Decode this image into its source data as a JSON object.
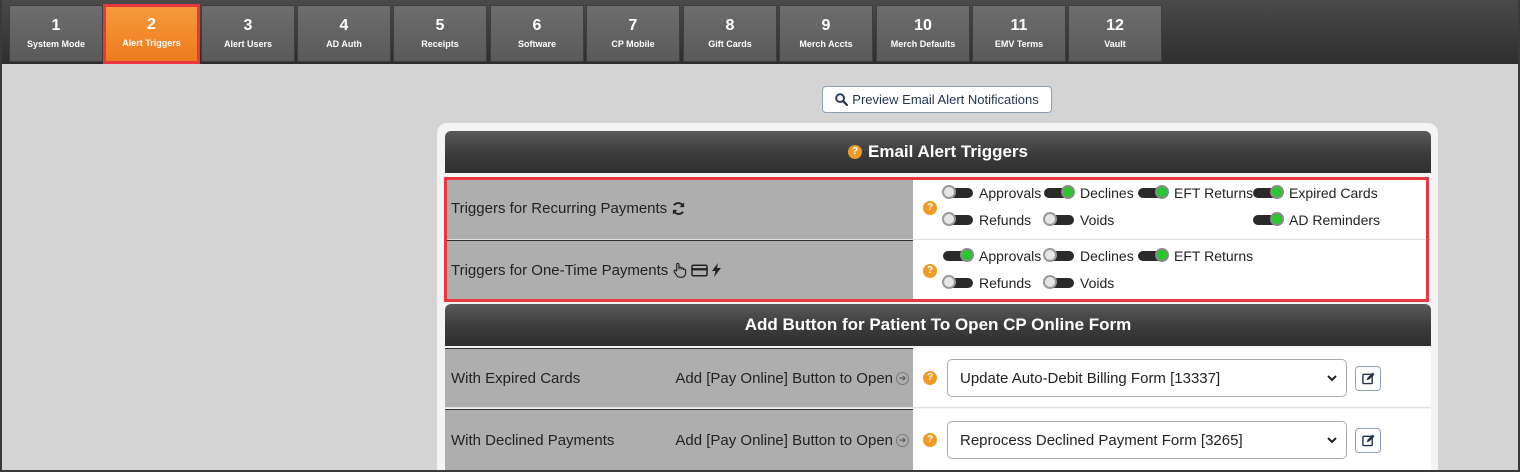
{
  "tabs": [
    {
      "num": "1",
      "label": "System Mode"
    },
    {
      "num": "2",
      "label": "Alert Triggers"
    },
    {
      "num": "3",
      "label": "Alert Users"
    },
    {
      "num": "4",
      "label": "AD Auth"
    },
    {
      "num": "5",
      "label": "Receipts"
    },
    {
      "num": "6",
      "label": "Software"
    },
    {
      "num": "7",
      "label": "CP Mobile"
    },
    {
      "num": "8",
      "label": "Gift Cards"
    },
    {
      "num": "9",
      "label": "Merch Accts"
    },
    {
      "num": "10",
      "label": "Merch Defaults"
    },
    {
      "num": "11",
      "label": "EMV Terms"
    },
    {
      "num": "12",
      "label": "Vault"
    }
  ],
  "preview_button": "Preview Email Alert Notifications",
  "triggers_section": {
    "title": "Email Alert Triggers",
    "recurring": {
      "label": "Triggers for Recurring Payments",
      "toggles": {
        "approvals": {
          "label": "Approvals",
          "on": false
        },
        "declines": {
          "label": "Declines",
          "on": true
        },
        "eft_returns": {
          "label": "EFT Returns",
          "on": true
        },
        "expired_cards": {
          "label": "Expired Cards",
          "on": true
        },
        "refunds": {
          "label": "Refunds",
          "on": false
        },
        "voids": {
          "label": "Voids",
          "on": false
        },
        "ad_reminders": {
          "label": "AD Reminders",
          "on": true
        }
      }
    },
    "one_time": {
      "label": "Triggers for One-Time Payments",
      "toggles": {
        "approvals": {
          "label": "Approvals",
          "on": true
        },
        "declines": {
          "label": "Declines",
          "on": false
        },
        "eft_returns": {
          "label": "EFT Returns",
          "on": true
        },
        "refunds": {
          "label": "Refunds",
          "on": false
        },
        "voids": {
          "label": "Voids",
          "on": false
        }
      }
    }
  },
  "button_section": {
    "title": "Add Button for Patient To Open CP Online Form",
    "rows": [
      {
        "label": "With Expired Cards",
        "action": "Add [Pay Online] Button to Open",
        "selected": "Update Auto-Debit Billing Form [13337]"
      },
      {
        "label": "With Declined Payments",
        "action": "Add [Pay Online] Button to Open",
        "selected": "Reprocess Declined Payment Form [3265]"
      }
    ]
  }
}
